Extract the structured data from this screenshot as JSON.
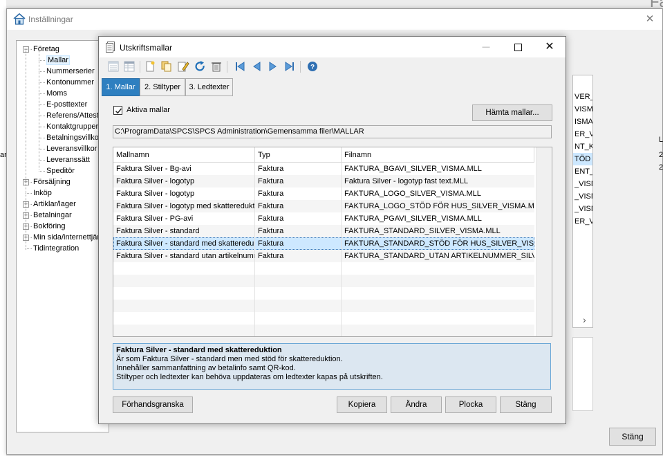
{
  "background": {
    "corner_text": "Fa",
    "left_cell": "ar",
    "right_cells": [
      "L",
      "2",
      "2"
    ]
  },
  "settings": {
    "title": "Inställningar",
    "close_glyph": "✕",
    "stang_label": "Stäng",
    "tree": [
      {
        "label": "Företag",
        "expander": "−"
      },
      {
        "label": "Mallar",
        "selected": true
      },
      {
        "label": "Nummerserier"
      },
      {
        "label": "Kontonummer"
      },
      {
        "label": "Moms"
      },
      {
        "label": "E-posttexter"
      },
      {
        "label": "Referens/Attest"
      },
      {
        "label": "Kontaktgrupperi"
      },
      {
        "label": "Betalningsvillkor"
      },
      {
        "label": "Leveransvillkor"
      },
      {
        "label": "Leveranssätt"
      },
      {
        "label": "Speditör"
      },
      {
        "label": "Försäljning",
        "expander": "+"
      },
      {
        "label": "Inköp"
      },
      {
        "label": "Artiklar/lager",
        "expander": "+"
      },
      {
        "label": "Betalningar",
        "expander": "+"
      },
      {
        "label": "Bokföring",
        "expander": "+"
      },
      {
        "label": "Min sida/internettjän",
        "expander": "+"
      },
      {
        "label": "Tidintegration"
      }
    ],
    "bg_grid_cells": [
      "VER_",
      "VISMA",
      "ISMA.",
      "ER_VI",
      "NT_KO",
      "TÖD F",
      "ENT_",
      "_VISM",
      "_VISM",
      "_VISM",
      "ER_V"
    ],
    "bg_scroll_glyph": "›"
  },
  "dialog": {
    "title": "Utskriftsmallar",
    "minimize_glyph": "—",
    "maximize_glyph": "☐",
    "close_glyph": "✕",
    "tabs": [
      "1. Mallar",
      "2. Stiltyper",
      "3. Ledtexter"
    ],
    "active_tab": 0,
    "aktiva_label": "Aktiva mallar",
    "hamta_label": "Hämta mallar...",
    "path": "C:\\ProgramData\\SPCS\\SPCS Administration\\Gemensamma filer\\MALLAR",
    "columns": [
      "Mallnamn",
      "Typ",
      "Filnamn"
    ],
    "rows": [
      {
        "name": "Faktura Silver - Bg-avi",
        "type": "Faktura",
        "file": "FAKTURA_BGAVI_SILVER_VISMA.MLL"
      },
      {
        "name": "Faktura Silver - logotyp",
        "type": "Faktura",
        "file": "Faktura Silver - logotyp fast text.MLL"
      },
      {
        "name": "Faktura Silver - logotyp",
        "type": "Faktura",
        "file": "FAKTURA_LOGO_SILVER_VISMA.MLL"
      },
      {
        "name": "Faktura Silver - logotyp med skattereduktion",
        "type": "Faktura",
        "file": "FAKTURA_LOGO_STÖD FÖR HUS_SILVER_VISMA.MLL"
      },
      {
        "name": "Faktura Silver - PG-avi",
        "type": "Faktura",
        "file": "FAKTURA_PGAVI_SILVER_VISMA.MLL"
      },
      {
        "name": "Faktura Silver - standard",
        "type": "Faktura",
        "file": "FAKTURA_STANDARD_SILVER_VISMA.MLL"
      },
      {
        "name": "Faktura Silver - standard med skattereduktion",
        "type": "Faktura",
        "file": "FAKTURA_STANDARD_STÖD FÖR HUS_SILVER_VISMA.MLL"
      },
      {
        "name": "Faktura Silver - standard utan artikelnummer",
        "type": "Faktura",
        "file": "FAKTURA_STANDARD_UTAN ARTIKELNUMMER_SILVER_VISMA.MLL"
      }
    ],
    "selected_row": 6,
    "description": {
      "title": "Faktura Silver - standard med skattereduktion",
      "lines": [
        "Är som Faktura Silver - standard men med stöd för skattereduktion.",
        "Innehåller sammanfattning av betalinfo samt QR-kod.",
        "Stiltyper och ledtexter kan behöva uppdateras om ledtexter kapas på utskriften."
      ]
    },
    "buttons": {
      "preview": "Förhandsgranska",
      "copy": "Kopiera",
      "edit": "Ändra",
      "pick": "Plocka",
      "close": "Stäng"
    },
    "toolbar_icons": [
      "list-view-icon",
      "detail-view-icon",
      "new-icon",
      "copy-icon",
      "edit-icon",
      "refresh-icon",
      "delete-icon",
      "first-icon",
      "previous-icon",
      "next-icon",
      "last-icon",
      "help-icon"
    ],
    "colors": {
      "accent": "#2e7fc0",
      "selected_row": "#cde8ff",
      "description_bg": "#dce7f1"
    }
  }
}
